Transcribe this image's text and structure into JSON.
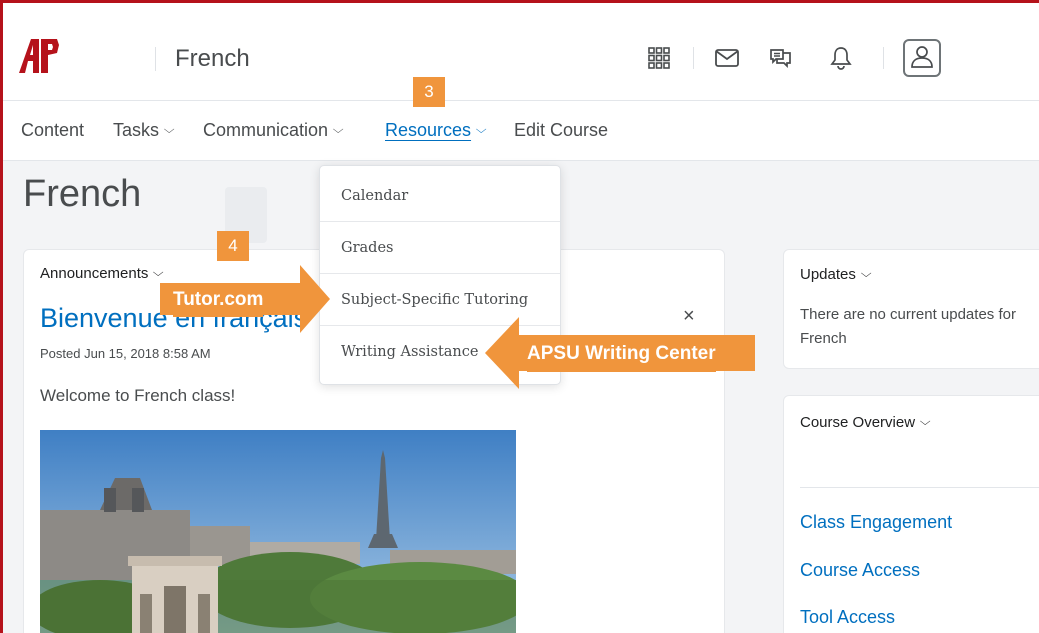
{
  "header": {
    "logo_text": "AP",
    "course_title": "French"
  },
  "nav": {
    "items": [
      {
        "label": "Content",
        "has_dropdown": false
      },
      {
        "label": "Tasks",
        "has_dropdown": true
      },
      {
        "label": "Communication",
        "has_dropdown": true
      },
      {
        "label": "Resources",
        "has_dropdown": true,
        "active": true
      },
      {
        "label": "Edit Course",
        "has_dropdown": false
      }
    ]
  },
  "page": {
    "title": "French"
  },
  "announcements": {
    "heading": "Announcements",
    "title": "Bienvenue en français",
    "posted": "Posted Jun 15, 2018 8:58 AM",
    "body": "Welcome to French class!",
    "close_glyph": "×"
  },
  "dropdown": {
    "items": [
      "Calendar",
      "Grades",
      "Subject-Specific Tutoring",
      "Writing Assistance"
    ]
  },
  "updates": {
    "heading": "Updates",
    "text": "There are no current updates for French"
  },
  "course_overview": {
    "heading": "Course Overview",
    "links": [
      "Class Engagement",
      "Course Access",
      "Tool Access"
    ]
  },
  "annotations": {
    "badge_3": "3",
    "badge_4": "4",
    "callout_tutor": "Tutor.com",
    "callout_writing": "APSU Writing Center"
  },
  "icons": [
    "waffle-icon",
    "mail-icon",
    "chat-icon",
    "bell-icon",
    "avatar-icon",
    "chevron-down-icon",
    "close-icon"
  ],
  "colors": {
    "brand_red": "#b5121b",
    "link_blue": "#006fbf",
    "callout_orange": "#f0953c"
  }
}
